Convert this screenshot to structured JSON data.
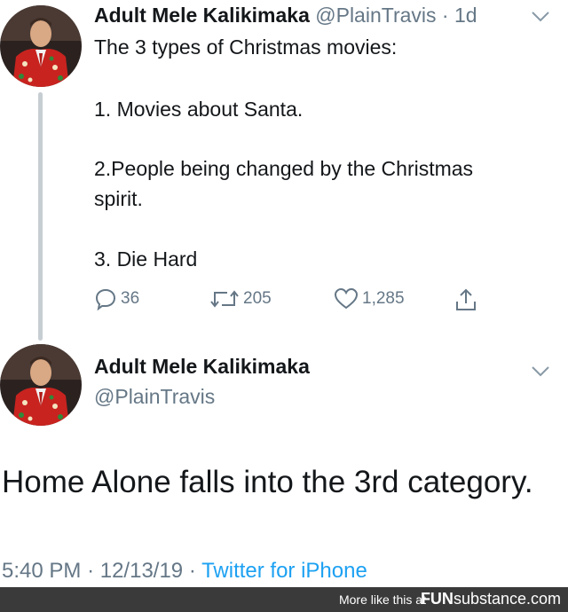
{
  "tweet1": {
    "display_name": "Adult Mele Kalikimaka",
    "handle": "@PlainTravis",
    "age": "1d",
    "lines": [
      "The 3 types of Christmas movies:",
      "1. Movies about Santa.",
      "2.People being changed by the Christmas",
      "spirit.",
      "3. Die Hard"
    ],
    "replies": "36",
    "retweets": "205",
    "likes": "1,285"
  },
  "tweet2": {
    "display_name": "Adult Mele Kalikimaka",
    "handle": "@PlainTravis",
    "text": "Home Alone falls into the 3rd category.",
    "time": "5:40 PM",
    "date": "12/13/19",
    "source": "Twitter for iPhone"
  },
  "footer": {
    "more_text": "More like this at",
    "brand_bold": "FUN",
    "brand_rest": "substance.com"
  },
  "colors": {
    "text": "#14171a",
    "muted": "#657786",
    "link": "#1da1f2",
    "suit_red": "#c8231f",
    "footer_bg": "#3a3a3a"
  }
}
